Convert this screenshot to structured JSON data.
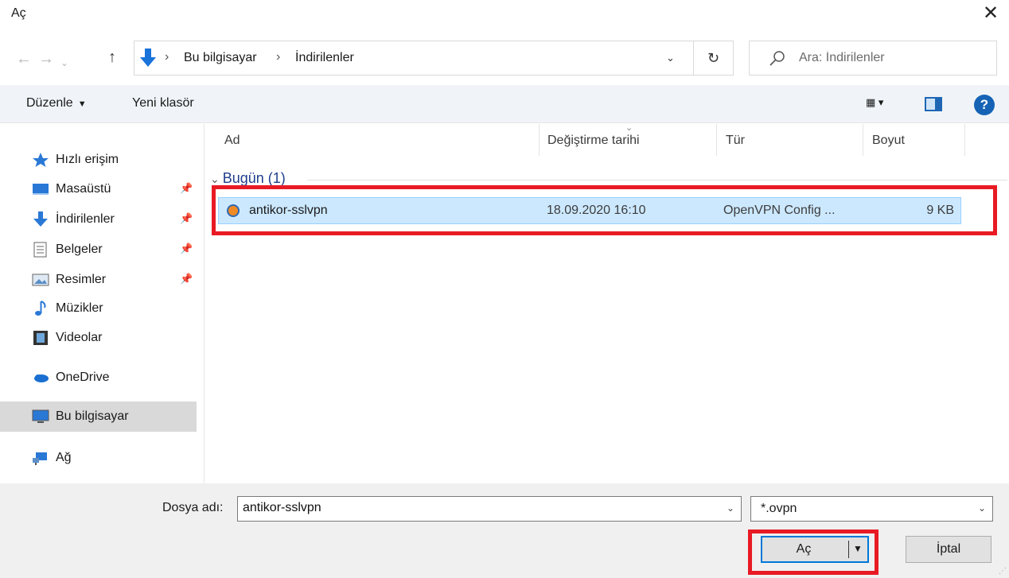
{
  "window": {
    "title": "Aç",
    "close_glyph": "✕"
  },
  "nav": {
    "back_glyph": "←",
    "forward_glyph": "→",
    "recent_glyph": "⌄",
    "up_glyph": "↑",
    "address_icon": "downloads-arrow-icon",
    "breadcrumb": [
      "Bu bilgisayar",
      "İndirilenler"
    ],
    "separator": "›",
    "dropdown_glyph": "⌄",
    "refresh_glyph": "↻",
    "search_placeholder": "Ara: İndirilenler"
  },
  "toolbar": {
    "organize": "Düzenle",
    "organize_arrow": "▼",
    "new_folder": "Yeni klasör",
    "view_glyph": "▦ ▾",
    "help_glyph": "?"
  },
  "sidebar": {
    "items": [
      {
        "label": "Hızlı erişim",
        "icon": "star-icon",
        "pinned": false
      },
      {
        "label": "Masaüstü",
        "icon": "desktop-icon",
        "pinned": true
      },
      {
        "label": "İndirilenler",
        "icon": "download-icon",
        "pinned": true
      },
      {
        "label": "Belgeler",
        "icon": "document-icon",
        "pinned": true
      },
      {
        "label": "Resimler",
        "icon": "pictures-icon",
        "pinned": true
      },
      {
        "label": "Müzikler",
        "icon": "music-icon",
        "pinned": false
      },
      {
        "label": "Videolar",
        "icon": "video-icon",
        "pinned": false
      },
      {
        "label": "OneDrive",
        "icon": "cloud-icon",
        "pinned": false
      },
      {
        "label": "Bu bilgisayar",
        "icon": "computer-icon",
        "pinned": false,
        "selected": true
      },
      {
        "label": "Ağ",
        "icon": "network-icon",
        "pinned": false
      }
    ],
    "pin_glyph": "📌"
  },
  "columns": {
    "name": "Ad",
    "date": "Değiştirme tarihi",
    "type": "Tür",
    "size": "Boyut",
    "sort_glyph": "⌄"
  },
  "group": {
    "chevron": "⌄",
    "label": "Bugün (1)"
  },
  "files": [
    {
      "name": "antikor-sslvpn",
      "date": "18.09.2020 16:10",
      "type": "OpenVPN Config ...",
      "size": "9 KB",
      "icon": "openvpn-config-icon"
    }
  ],
  "footer": {
    "filename_label": "Dosya adı:",
    "filename_value": "antikor-sslvpn",
    "filetype_value": "*.ovpn",
    "dropdown_glyph": "⌄",
    "open_label": "Aç",
    "open_split_glyph": "▼",
    "cancel_label": "İptal"
  },
  "colors": {
    "highlight": "#e81a24",
    "selection": "#cce8ff",
    "accent": "#0078d7"
  }
}
